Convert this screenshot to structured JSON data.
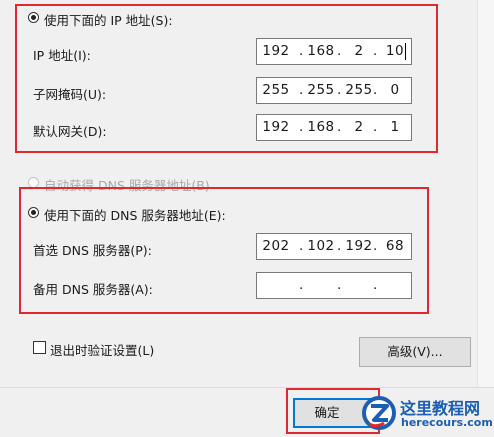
{
  "static_ip": {
    "radio_label": "使用下面的 IP 地址(S):",
    "ip_label": "IP 地址(I):",
    "ip": [
      "192",
      "168",
      "2",
      "10"
    ],
    "mask_label": "子网掩码(U):",
    "mask": [
      "255",
      "255",
      "255",
      "0"
    ],
    "gateway_label": "默认网关(D):",
    "gateway": [
      "192",
      "168",
      "2",
      "1"
    ]
  },
  "auto_dns": {
    "radio_label": "自动获得 DNS 服务器地址(B)"
  },
  "static_dns": {
    "radio_label": "使用下面的 DNS 服务器地址(E):",
    "preferred_label": "首选 DNS 服务器(P):",
    "preferred": [
      "202",
      "102",
      "192",
      "68"
    ],
    "alternate_label": "备用 DNS 服务器(A):",
    "alternate": [
      "",
      "",
      "",
      ""
    ]
  },
  "validate_checkbox_label": "退出时验证设置(L)",
  "advanced_button_label": "高级(V)...",
  "ok_button_label": "确定",
  "watermark": {
    "title": "这里教程网",
    "url": "herecours.com"
  },
  "colors": {
    "highlight": "#e0292e",
    "watermark_blue": "#1a5fb4"
  }
}
